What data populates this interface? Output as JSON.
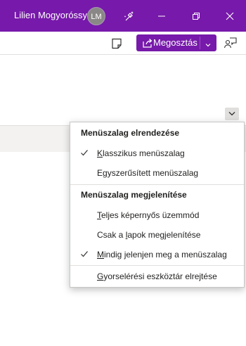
{
  "titlebar": {
    "user_name": "Lilien Mogyoróssy",
    "avatar_initials": "LM",
    "buttons": [
      "brush-icon",
      "minimize-icon",
      "restore-icon",
      "close-icon"
    ],
    "accent": "#7719aa"
  },
  "toolbar": {
    "share_label": "Megosztás",
    "icons": [
      "note-icon",
      "share-icon",
      "chevron-down-icon",
      "feedback-icon"
    ]
  },
  "menu": {
    "section1_header": "Menüszalag elrendezése",
    "items1": [
      {
        "pre": "",
        "u": "K",
        "post": "lasszikus menüszalag",
        "checked": true
      },
      {
        "pre": "E",
        "u": "g",
        "post": "yszerűsített menüszalag",
        "checked": false
      }
    ],
    "section2_header": "Menüszalag megjelenítése",
    "items2": [
      {
        "pre": "",
        "u": "T",
        "post": "eljes képernyős üzemmód",
        "checked": false
      },
      {
        "pre": "Csak a ",
        "u": "l",
        "post": "apok megjelenítése",
        "checked": false
      },
      {
        "pre": "",
        "u": "M",
        "post": "indig jelenjen meg a menüszalag",
        "checked": true
      }
    ],
    "items3": [
      {
        "pre": "",
        "u": "G",
        "post": "yorselérési eszköztár elrejtése",
        "checked": false
      }
    ]
  }
}
